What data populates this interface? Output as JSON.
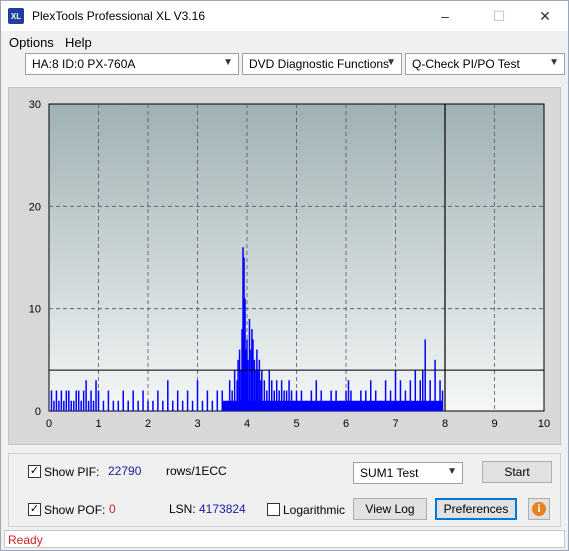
{
  "window": {
    "title": "PlexTools Professional XL V3.16",
    "app_icon_text": "XL",
    "minimize": "–",
    "maximize": "☐",
    "close": "✕"
  },
  "menu": [
    {
      "label": "Options"
    },
    {
      "label": "Help"
    }
  ],
  "toolbar": {
    "drive": "HA:8 ID:0  PX-760A",
    "function": "DVD Diagnostic Functions",
    "test": "Q-Check PI/PO Test"
  },
  "chart_data": {
    "type": "bar",
    "xlim": [
      0,
      10
    ],
    "ylim": [
      0,
      30
    ],
    "x_ticks": [
      "0",
      "1",
      "2",
      "3",
      "4",
      "5",
      "6",
      "7",
      "8",
      "9",
      "10"
    ],
    "y_ticks": [
      "0",
      "10",
      "20",
      "30"
    ],
    "grid": true,
    "threshold_line": 4,
    "end_marker_x": 8,
    "colors": {
      "plot_bg_top": "#9fb1b4",
      "plot_bg_bottom": "#f5f7f7",
      "bars": "#0000ff",
      "axis_bg": "#d8d8d8"
    },
    "x": [
      0.05,
      0.1,
      0.15,
      0.2,
      0.25,
      0.3,
      0.35,
      0.4,
      0.45,
      0.5,
      0.55,
      0.6,
      0.65,
      0.7,
      0.75,
      0.8,
      0.85,
      0.9,
      0.95,
      1.0,
      1.1,
      1.2,
      1.3,
      1.4,
      1.5,
      1.6,
      1.7,
      1.8,
      1.9,
      2.0,
      2.1,
      2.2,
      2.3,
      2.4,
      2.5,
      2.6,
      2.7,
      2.8,
      2.9,
      3.0,
      3.1,
      3.2,
      3.3,
      3.4,
      3.5,
      3.6,
      3.65,
      3.7,
      3.75,
      3.8,
      3.82,
      3.85,
      3.88,
      3.9,
      3.92,
      3.94,
      3.96,
      3.98,
      4.0,
      4.02,
      4.05,
      4.08,
      4.1,
      4.12,
      4.15,
      4.18,
      4.2,
      4.22,
      4.25,
      4.28,
      4.3,
      4.35,
      4.4,
      4.45,
      4.5,
      4.55,
      4.6,
      4.65,
      4.7,
      4.75,
      4.8,
      4.85,
      4.9,
      4.95,
      5.0,
      5.1,
      5.2,
      5.3,
      5.4,
      5.5,
      5.6,
      5.7,
      5.8,
      5.9,
      6.0,
      6.05,
      6.1,
      6.2,
      6.3,
      6.4,
      6.5,
      6.6,
      6.7,
      6.8,
      6.9,
      7.0,
      7.1,
      7.2,
      7.3,
      7.4,
      7.5,
      7.55,
      7.6,
      7.7,
      7.8,
      7.9,
      7.95
    ],
    "values": [
      2,
      1,
      2,
      1,
      2,
      1,
      2,
      2,
      1,
      1,
      2,
      2,
      1,
      2,
      3,
      1,
      2,
      1,
      3,
      2,
      1,
      2,
      1,
      1,
      2,
      1,
      2,
      1,
      2,
      1,
      1,
      2,
      1,
      3,
      1,
      2,
      1,
      2,
      1,
      3,
      1,
      2,
      1,
      2,
      2,
      1,
      3,
      2,
      4,
      3,
      5,
      6,
      4,
      8,
      16,
      15,
      11,
      6,
      7,
      5,
      9,
      6,
      8,
      7,
      5,
      4,
      6,
      4,
      5,
      3,
      4,
      3,
      2,
      4,
      3,
      2,
      3,
      2,
      3,
      2,
      2,
      3,
      2,
      1,
      2,
      2,
      1,
      2,
      3,
      2,
      1,
      2,
      2,
      1,
      2,
      3,
      2,
      1,
      2,
      2,
      3,
      2,
      1,
      3,
      2,
      4,
      3,
      2,
      3,
      4,
      3,
      4,
      7,
      3,
      5,
      3,
      2
    ]
  },
  "controls": {
    "show_pif_label": "Show PIF:",
    "pif_value": "22790",
    "pif_unit": "rows/1ECC",
    "show_pof_label": "Show POF:",
    "pof_value": "0",
    "lsn_label": "LSN:",
    "lsn_value": "4173824",
    "logarithmic_label": "Logarithmic",
    "mode_select": "SUM1 Test",
    "start_button": "Start",
    "view_log_button": "View Log",
    "preferences_button": "Preferences",
    "info_button": "i",
    "show_pif_checked": "✓",
    "show_pof_checked": "✓"
  },
  "status": {
    "text": "Ready"
  }
}
